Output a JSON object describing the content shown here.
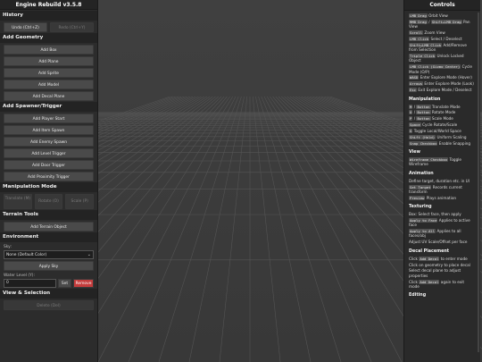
{
  "app": {
    "title": "Engine Rebuild v3.5.8"
  },
  "history": {
    "header": "History",
    "undo": "Undo (Ctrl+Z)",
    "redo": "Redo (Ctrl+Y)"
  },
  "geometry": {
    "header": "Add Geometry",
    "buttons": [
      "Add Box",
      "Add Plane",
      "Add Sprite",
      "Add Model",
      "Add Decal Plane"
    ]
  },
  "spawner": {
    "header": "Add Spawner/Trigger",
    "buttons": [
      "Add Player Start",
      "Add Item Spawn",
      "Add Enemy Spawn",
      "Add Level Trigger",
      "Add Door Trigger",
      "Add Proximity Trigger"
    ]
  },
  "manipulation": {
    "header": "Manipulation Mode",
    "translate": "Translate (M)",
    "rotate": "Rotate (O)",
    "scale": "Scale (P)"
  },
  "terrain": {
    "header": "Terrain Tools",
    "add": "Add Terrain Object"
  },
  "environment": {
    "header": "Environment",
    "sky_label": "Sky:",
    "sky_value": "None (Default Color)",
    "apply_sky": "Apply Sky",
    "water_label": "Water Level (Y):",
    "water_value": "0",
    "set": "Set",
    "remove": "Remove"
  },
  "view_selection": {
    "header": "View & Selection",
    "delete": "Delete (Del)"
  },
  "controls": {
    "title": "Controls",
    "camera": [
      {
        "k1": "LMB Drag",
        "t1": "Orbit View"
      },
      {
        "k1": "MMB Drag",
        "t1": "/",
        "k2": "Shift+LMB Drag",
        "t2": "Pan View"
      },
      {
        "k1": "Scroll",
        "t1": "Zoom View"
      },
      {
        "k1": "LMB Click",
        "t1": "Select / Deselect"
      },
      {
        "k1": "Shift+LMB Click",
        "t1": "Add/Remove from Selection"
      },
      {
        "k1": "Triple Click",
        "t1": "Unlock Locked Object"
      },
      {
        "k1": "LMB Click (Gizmo Center)",
        "t1": "Cycle Mode (O/P)"
      },
      {
        "k1": "WASD",
        "t1": "Enter Explore Mode (Hover)"
      },
      {
        "k1": "Arrows",
        "t1": "Enter Explore Mode (Look)"
      },
      {
        "k1": "Esc",
        "t1": "Exit Explore Mode / Deselect"
      }
    ],
    "manipulation_header": "Manipulation",
    "manipulation": [
      {
        "k1": "M",
        "t1": "/",
        "k2": "Button",
        "t2": "Translate Mode"
      },
      {
        "k1": "O",
        "t1": "/",
        "k2": "Button",
        "t2": "Rotate Mode"
      },
      {
        "k1": "P",
        "t1": "/",
        "k2": "Button",
        "t2": "Scale Mode"
      },
      {
        "k1": "Space",
        "t1": "Cycle Rotate/Scale"
      },
      {
        "k1": "G",
        "t1": "Toggle Local/World Space"
      },
      {
        "k1": "Shift (Hold)",
        "t1": "Uniform Scaling"
      },
      {
        "k1": "Snap Checkbox",
        "t1": "Enable Snapping"
      }
    ],
    "view_header": "View",
    "view": [
      {
        "k1": "Wireframe Checkbox",
        "t1": "Toggle Wireframe"
      }
    ],
    "animation_header": "Animation",
    "animation": [
      {
        "t0": "Define target, duration etc. in UI"
      },
      {
        "k1": "Set Target",
        "t1": "Records current transform"
      },
      {
        "k1": "Preview",
        "t1": "Plays animation"
      }
    ],
    "texturing_header": "Texturing",
    "texturing": [
      {
        "t0": "Box: Select face, then apply"
      },
      {
        "k1": "Apply to Face",
        "t1": "Applies to active face"
      },
      {
        "k1": "Apply to All",
        "t1": "Applies to all faces/obj"
      },
      {
        "t0": "Adjust UV Scale/Offset per face"
      }
    ],
    "decal_header": "Decal Placement",
    "decal": [
      {
        "t0": "Click",
        "k1": "Add Decal",
        "t1": "to enter mode"
      },
      {
        "t0": "Click on geometry to place decal"
      },
      {
        "t0": "Select decal plane to adjust properties"
      },
      {
        "t0": "Click",
        "k1": "Add Decal",
        "t1": "again to exit mode"
      }
    ],
    "editing_header": "Editing"
  },
  "colors": {
    "panel_bg": "#2c2c2c",
    "section_bg": "#232323",
    "button_bg": "#4a4a4a",
    "danger": "#c43c3c",
    "viewport_bg": "#3c3c3c",
    "grid_line": "#545454"
  }
}
